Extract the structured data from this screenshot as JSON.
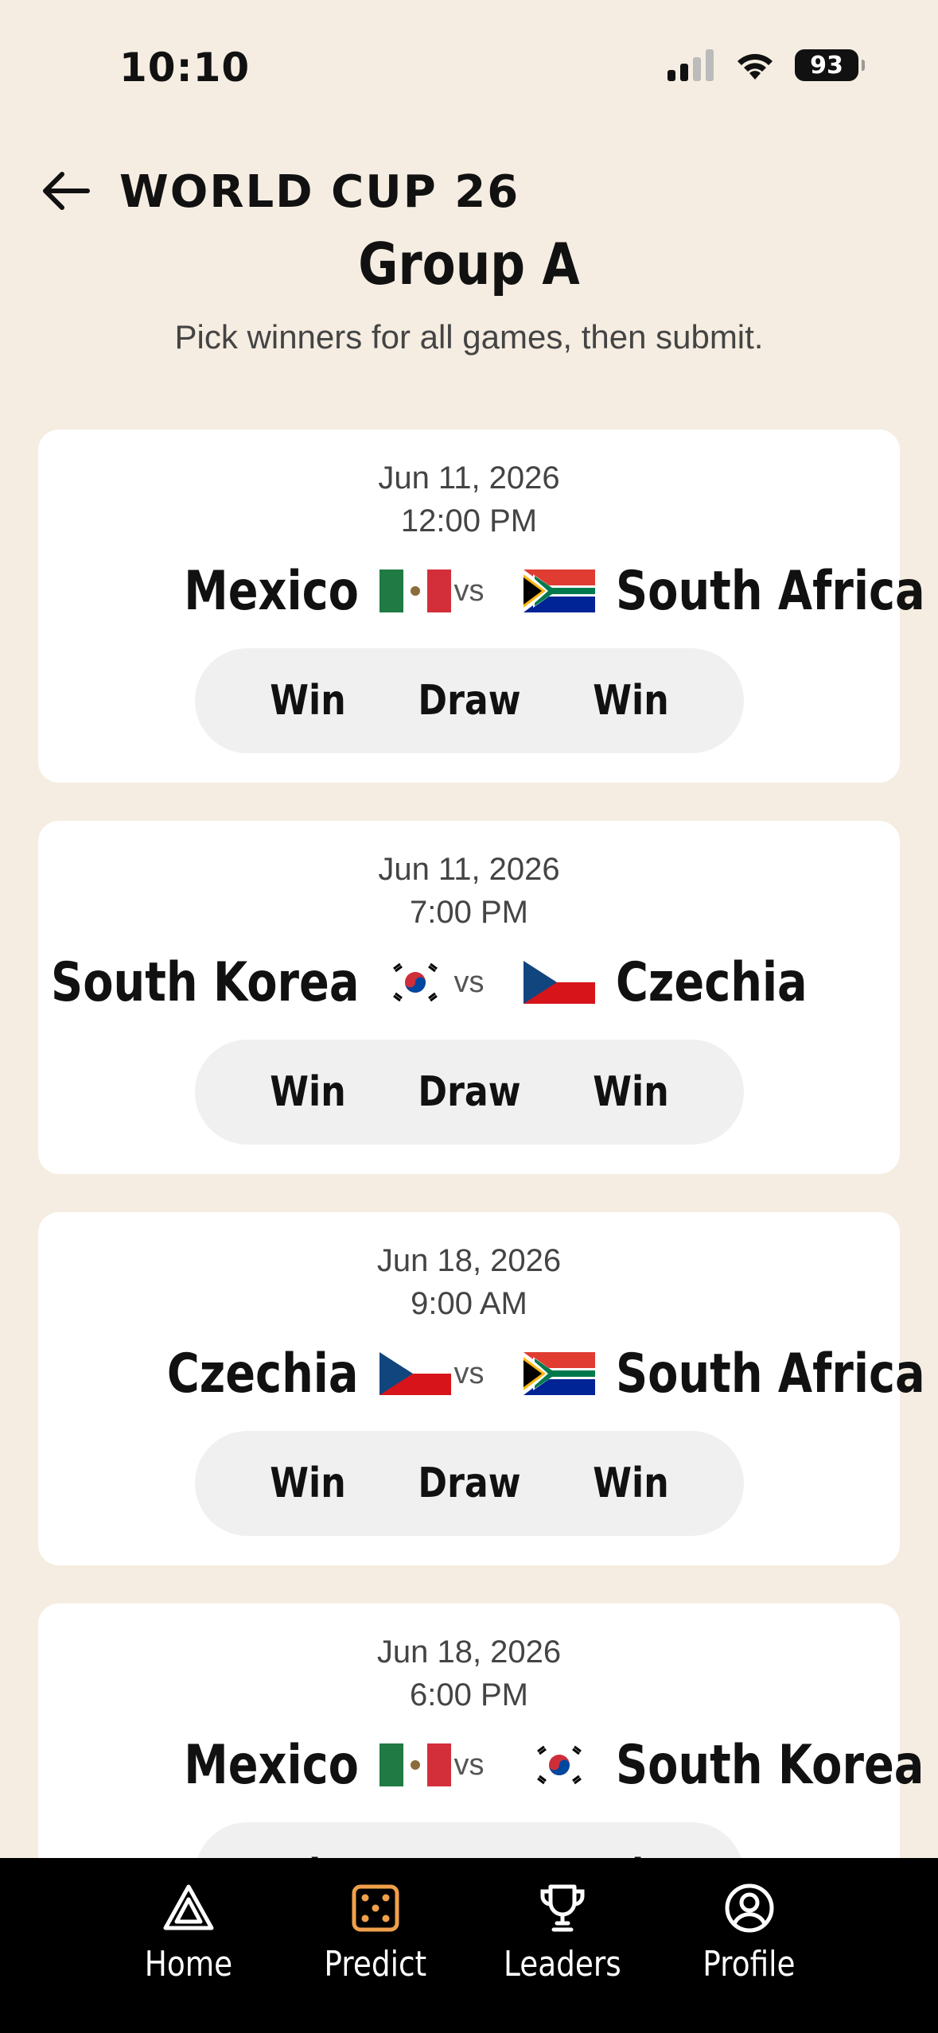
{
  "status_bar": {
    "time": "10:10",
    "battery": "93"
  },
  "header": {
    "brand": "WORLD CUP 26",
    "title": "Group A",
    "subtitle": "Pick winners for all games, then submit."
  },
  "vs_label": "vs",
  "picks": {
    "home": "Win",
    "draw": "Draw",
    "away": "Win"
  },
  "matches": [
    {
      "date": "Jun 11, 2026",
      "time": "12:00 PM",
      "home": "Mexico",
      "away": "South Africa"
    },
    {
      "date": "Jun 11, 2026",
      "time": "7:00 PM",
      "home": "South Korea",
      "away": "Czechia"
    },
    {
      "date": "Jun 18, 2026",
      "time": "9:00 AM",
      "home": "Czechia",
      "away": "South Africa"
    },
    {
      "date": "Jun 18, 2026",
      "time": "6:00 PM",
      "home": "Mexico",
      "away": "South Korea"
    }
  ],
  "nav": {
    "home": "Home",
    "predict": "Predict",
    "leaders": "Leaders",
    "profile": "Profile"
  },
  "colors": {
    "background": "#f5ede1",
    "active_nav": "#f0a04b",
    "nav_bg": "#000000"
  }
}
